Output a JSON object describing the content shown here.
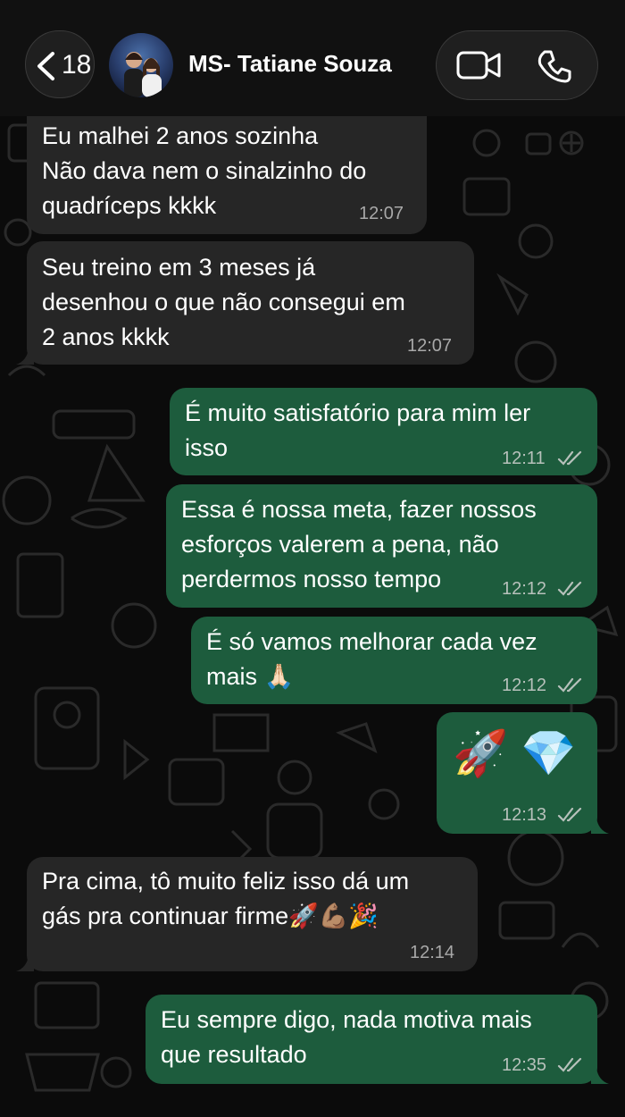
{
  "header": {
    "back_count": "18",
    "contact_name": "MS- Tatiane Souza"
  },
  "messages": [
    {
      "direction": "in",
      "text": "Eu malhei 2 anos sozinha\nNão dava nem o sinalzinho do\nquadríceps kkkk",
      "time": "12:07"
    },
    {
      "direction": "in",
      "text": "Seu treino em 3 meses já\ndesenhou o que não consegui em\n2 anos kkkk",
      "time": "12:07"
    },
    {
      "direction": "out",
      "text": "É muito satisfatório para mim ler\nisso",
      "time": "12:11",
      "status": "read"
    },
    {
      "direction": "out",
      "text": "Essa é nossa meta, fazer nossos\nesforços valerem a pena, não\nperdermos nosso tempo",
      "time": "12:12",
      "status": "read"
    },
    {
      "direction": "out",
      "text": "É só vamos melhorar cada vez\nmais 🙏🏻",
      "time": "12:12",
      "status": "read"
    },
    {
      "direction": "out",
      "text": "🚀 💎",
      "time": "12:13",
      "status": "read"
    },
    {
      "direction": "in",
      "text": "Pra cima, tô muito feliz isso dá um\ngás pra continuar firme🚀💪🏽🎉",
      "time": "12:14"
    },
    {
      "direction": "out",
      "text": "Eu sempre digo, nada motiva mais\nque resultado",
      "time": "12:35",
      "status": "read"
    }
  ],
  "colors": {
    "incoming_bubble": "#262626",
    "outgoing_bubble": "#1d5c3d",
    "background": "#0b0b0b"
  },
  "icons": [
    "back-chevron-icon",
    "video-call-icon",
    "phone-call-icon",
    "double-check-read-icon"
  ]
}
